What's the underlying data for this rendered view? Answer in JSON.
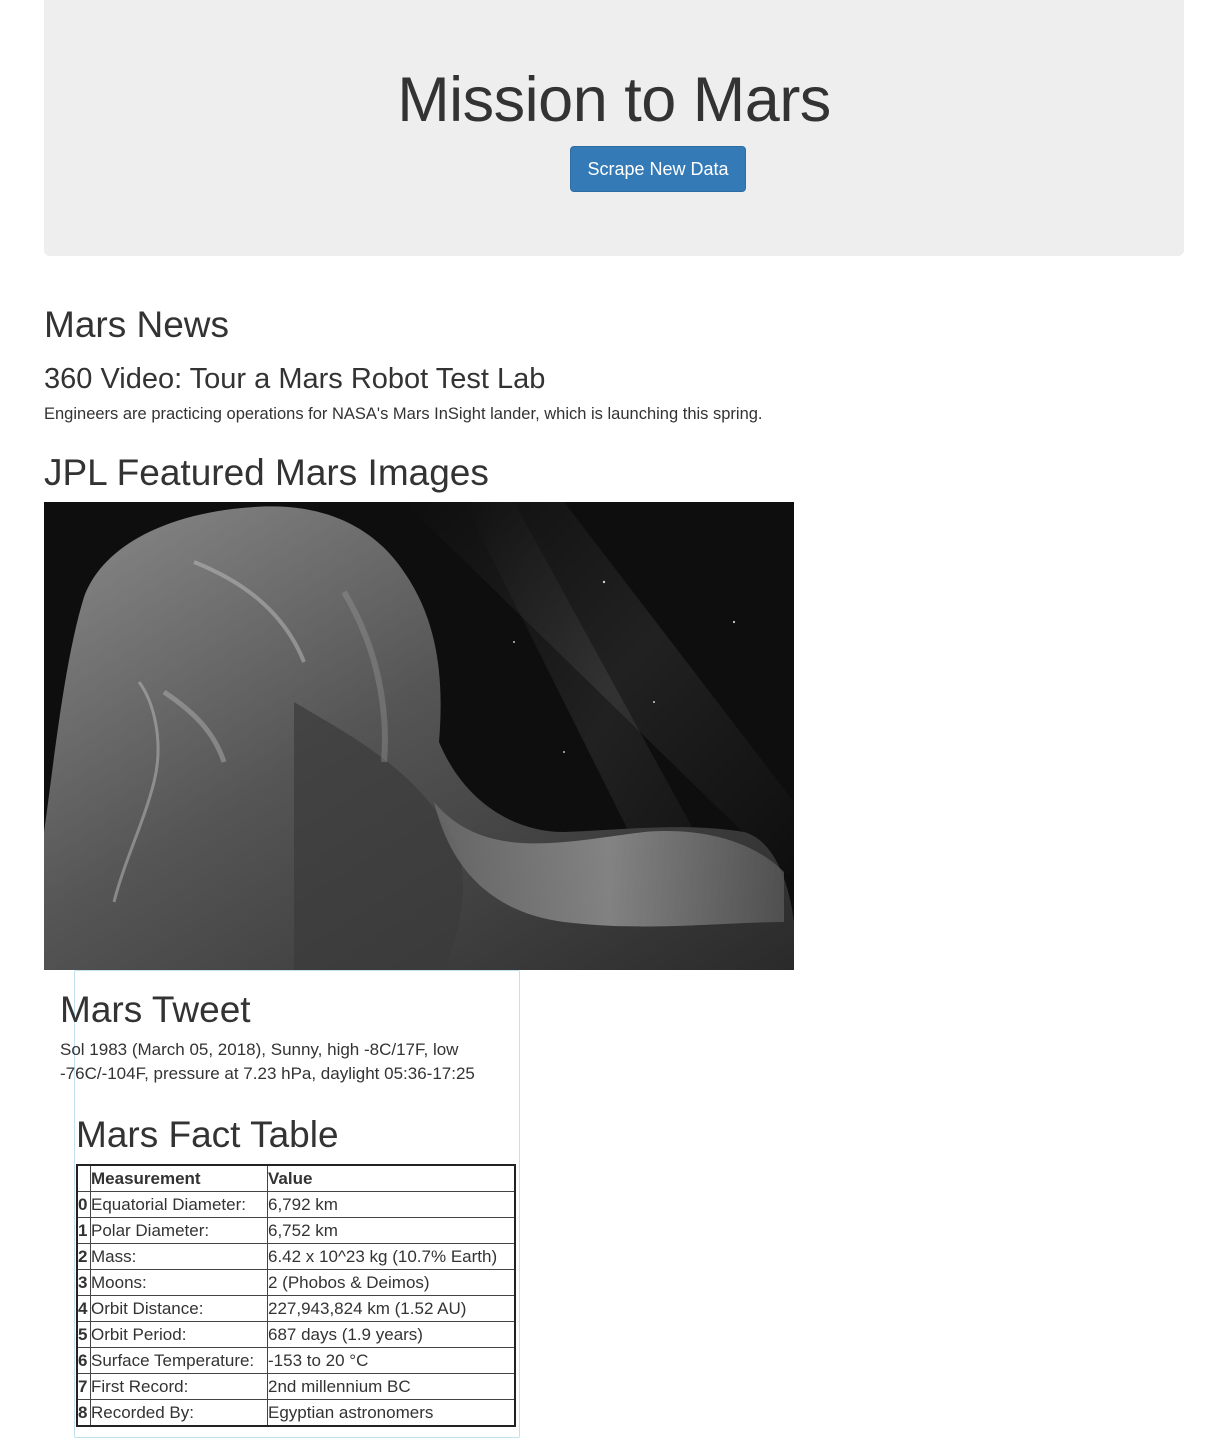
{
  "header": {
    "title": "Mission to Mars",
    "scrape_button": "Scrape New Data"
  },
  "news": {
    "heading": "Mars News",
    "title": "360 Video: Tour a Mars Robot Test Lab",
    "teaser": "Engineers are practicing operations for NASA's Mars InSight lander, which is launching this spring."
  },
  "images": {
    "heading": "JPL Featured Mars Images"
  },
  "tweet": {
    "heading": "Mars Tweet",
    "text": "Sol 1983 (March 05, 2018), Sunny, high -8C/17F, low -76C/-104F, pressure at 7.23 hPa, daylight 05:36-17:25"
  },
  "facts": {
    "heading": "Mars Fact Table",
    "columns": [
      "",
      "Measurement",
      "Value"
    ],
    "rows": [
      {
        "index": "0",
        "measurement": "Equatorial Diameter:",
        "value": "6,792 km"
      },
      {
        "index": "1",
        "measurement": "Polar Diameter:",
        "value": "6,752 km"
      },
      {
        "index": "2",
        "measurement": "Mass:",
        "value": "6.42 x 10^23 kg (10.7% Earth)"
      },
      {
        "index": "3",
        "measurement": "Moons:",
        "value": "2 (Phobos & Deimos)"
      },
      {
        "index": "4",
        "measurement": "Orbit Distance:",
        "value": "227,943,824 km (1.52 AU)"
      },
      {
        "index": "5",
        "measurement": "Orbit Period:",
        "value": "687 days (1.9 years)"
      },
      {
        "index": "6",
        "measurement": "Surface Temperature:",
        "value": "-153 to 20 °C"
      },
      {
        "index": "7",
        "measurement": "First Record:",
        "value": "2nd millennium BC"
      },
      {
        "index": "8",
        "measurement": "Recorded By:",
        "value": "Egyptian astronomers"
      }
    ]
  }
}
